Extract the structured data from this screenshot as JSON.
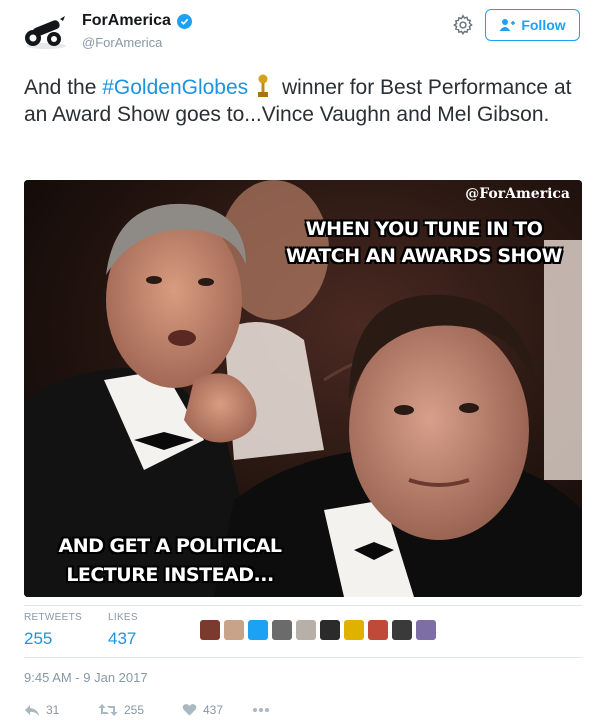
{
  "user": {
    "name": "ForAmerica",
    "handle": "@ForAmerica",
    "verified": true
  },
  "header": {
    "follow_label": "Follow"
  },
  "tweet": {
    "text_before": "And the ",
    "hashtag": "#GoldenGlobes",
    "text_after": " winner for Best Performance at an Award Show goes to...Vince Vaughn and Mel Gibson."
  },
  "media": {
    "watermark": "@ForAmerica",
    "top_caption": "WHEN YOU TUNE IN TO WATCH AN AWARDS SHOW",
    "bottom_caption": "AND GET A POLITICAL LECTURE INSTEAD..."
  },
  "stats": {
    "retweets_label": "RETWEETS",
    "retweets_value": "255",
    "likes_label": "LIKES",
    "likes_value": "437"
  },
  "timestamp": "9:45 AM - 9 Jan 2017",
  "actions": {
    "reply_count": "31",
    "retweet_count": "255",
    "like_count": "437"
  },
  "colors": {
    "accent": "#1da1f2",
    "link": "#1b95e0",
    "muted": "#8899a6"
  },
  "liker_colors": [
    "#7a3b2e",
    "#c9a28a",
    "#1da1f2",
    "#6b6b6b",
    "#b7b0a8",
    "#2b2b2b",
    "#e0b200",
    "#c04a3a",
    "#3a3a3a",
    "#7d6fa6"
  ]
}
